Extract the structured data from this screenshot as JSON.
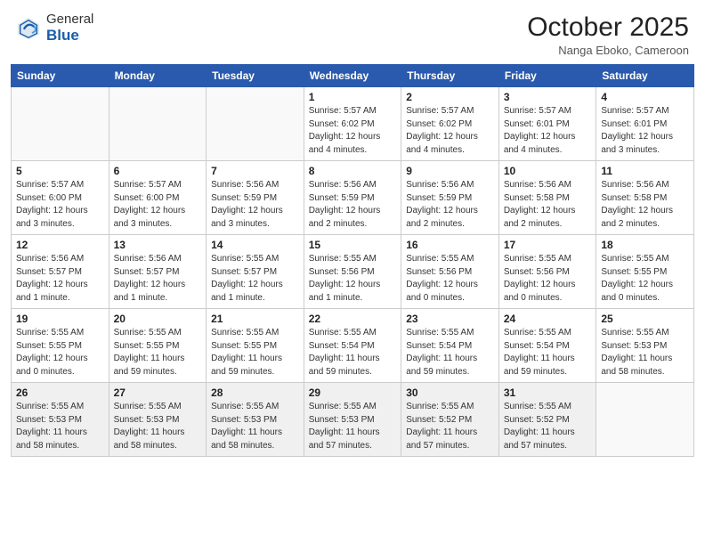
{
  "header": {
    "logo_general": "General",
    "logo_blue": "Blue",
    "month_title": "October 2025",
    "subtitle": "Nanga Eboko, Cameroon"
  },
  "days_of_week": [
    "Sunday",
    "Monday",
    "Tuesday",
    "Wednesday",
    "Thursday",
    "Friday",
    "Saturday"
  ],
  "weeks": [
    [
      {
        "day": "",
        "info": ""
      },
      {
        "day": "",
        "info": ""
      },
      {
        "day": "",
        "info": ""
      },
      {
        "day": "1",
        "info": "Sunrise: 5:57 AM\nSunset: 6:02 PM\nDaylight: 12 hours\nand 4 minutes."
      },
      {
        "day": "2",
        "info": "Sunrise: 5:57 AM\nSunset: 6:02 PM\nDaylight: 12 hours\nand 4 minutes."
      },
      {
        "day": "3",
        "info": "Sunrise: 5:57 AM\nSunset: 6:01 PM\nDaylight: 12 hours\nand 4 minutes."
      },
      {
        "day": "4",
        "info": "Sunrise: 5:57 AM\nSunset: 6:01 PM\nDaylight: 12 hours\nand 3 minutes."
      }
    ],
    [
      {
        "day": "5",
        "info": "Sunrise: 5:57 AM\nSunset: 6:00 PM\nDaylight: 12 hours\nand 3 minutes."
      },
      {
        "day": "6",
        "info": "Sunrise: 5:57 AM\nSunset: 6:00 PM\nDaylight: 12 hours\nand 3 minutes."
      },
      {
        "day": "7",
        "info": "Sunrise: 5:56 AM\nSunset: 5:59 PM\nDaylight: 12 hours\nand 3 minutes."
      },
      {
        "day": "8",
        "info": "Sunrise: 5:56 AM\nSunset: 5:59 PM\nDaylight: 12 hours\nand 2 minutes."
      },
      {
        "day": "9",
        "info": "Sunrise: 5:56 AM\nSunset: 5:59 PM\nDaylight: 12 hours\nand 2 minutes."
      },
      {
        "day": "10",
        "info": "Sunrise: 5:56 AM\nSunset: 5:58 PM\nDaylight: 12 hours\nand 2 minutes."
      },
      {
        "day": "11",
        "info": "Sunrise: 5:56 AM\nSunset: 5:58 PM\nDaylight: 12 hours\nand 2 minutes."
      }
    ],
    [
      {
        "day": "12",
        "info": "Sunrise: 5:56 AM\nSunset: 5:57 PM\nDaylight: 12 hours\nand 1 minute."
      },
      {
        "day": "13",
        "info": "Sunrise: 5:56 AM\nSunset: 5:57 PM\nDaylight: 12 hours\nand 1 minute."
      },
      {
        "day": "14",
        "info": "Sunrise: 5:55 AM\nSunset: 5:57 PM\nDaylight: 12 hours\nand 1 minute."
      },
      {
        "day": "15",
        "info": "Sunrise: 5:55 AM\nSunset: 5:56 PM\nDaylight: 12 hours\nand 1 minute."
      },
      {
        "day": "16",
        "info": "Sunrise: 5:55 AM\nSunset: 5:56 PM\nDaylight: 12 hours\nand 0 minutes."
      },
      {
        "day": "17",
        "info": "Sunrise: 5:55 AM\nSunset: 5:56 PM\nDaylight: 12 hours\nand 0 minutes."
      },
      {
        "day": "18",
        "info": "Sunrise: 5:55 AM\nSunset: 5:55 PM\nDaylight: 12 hours\nand 0 minutes."
      }
    ],
    [
      {
        "day": "19",
        "info": "Sunrise: 5:55 AM\nSunset: 5:55 PM\nDaylight: 12 hours\nand 0 minutes."
      },
      {
        "day": "20",
        "info": "Sunrise: 5:55 AM\nSunset: 5:55 PM\nDaylight: 11 hours\nand 59 minutes."
      },
      {
        "day": "21",
        "info": "Sunrise: 5:55 AM\nSunset: 5:55 PM\nDaylight: 11 hours\nand 59 minutes."
      },
      {
        "day": "22",
        "info": "Sunrise: 5:55 AM\nSunset: 5:54 PM\nDaylight: 11 hours\nand 59 minutes."
      },
      {
        "day": "23",
        "info": "Sunrise: 5:55 AM\nSunset: 5:54 PM\nDaylight: 11 hours\nand 59 minutes."
      },
      {
        "day": "24",
        "info": "Sunrise: 5:55 AM\nSunset: 5:54 PM\nDaylight: 11 hours\nand 59 minutes."
      },
      {
        "day": "25",
        "info": "Sunrise: 5:55 AM\nSunset: 5:53 PM\nDaylight: 11 hours\nand 58 minutes."
      }
    ],
    [
      {
        "day": "26",
        "info": "Sunrise: 5:55 AM\nSunset: 5:53 PM\nDaylight: 11 hours\nand 58 minutes."
      },
      {
        "day": "27",
        "info": "Sunrise: 5:55 AM\nSunset: 5:53 PM\nDaylight: 11 hours\nand 58 minutes."
      },
      {
        "day": "28",
        "info": "Sunrise: 5:55 AM\nSunset: 5:53 PM\nDaylight: 11 hours\nand 58 minutes."
      },
      {
        "day": "29",
        "info": "Sunrise: 5:55 AM\nSunset: 5:53 PM\nDaylight: 11 hours\nand 57 minutes."
      },
      {
        "day": "30",
        "info": "Sunrise: 5:55 AM\nSunset: 5:52 PM\nDaylight: 11 hours\nand 57 minutes."
      },
      {
        "day": "31",
        "info": "Sunrise: 5:55 AM\nSunset: 5:52 PM\nDaylight: 11 hours\nand 57 minutes."
      },
      {
        "day": "",
        "info": ""
      }
    ]
  ]
}
